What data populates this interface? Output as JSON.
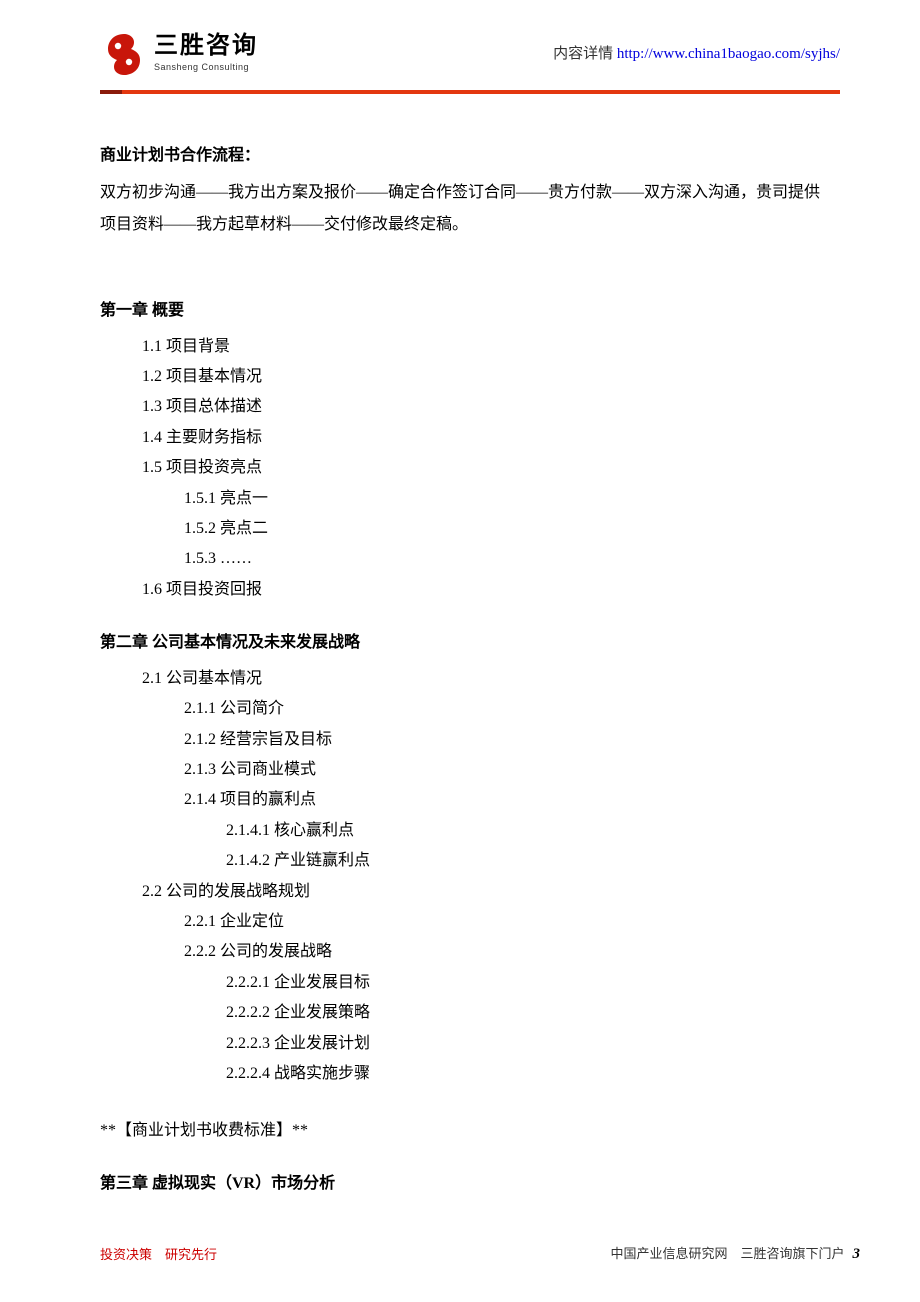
{
  "header": {
    "logo_cn": "三胜咨询",
    "logo_en": "Sansheng Consulting",
    "detail_label": "内容详情",
    "detail_url": "http://www.china1baogao.com/syjhs/"
  },
  "section": {
    "process_title": "商业计划书合作流程：",
    "process_text": "双方初步沟通——我方出方案及报价——确定合作签订合同——贵方付款——双方深入沟通，贵司提供项目资料——我方起草材料——交付修改最终定稿。"
  },
  "chapters": {
    "ch1": {
      "title": "第一章 概要",
      "items_l1": {
        "i0": "1.1 项目背景",
        "i1": "1.2 项目基本情况",
        "i2": "1.3 项目总体描述",
        "i3": "1.4 主要财务指标",
        "i4": "1.5 项目投资亮点",
        "i5": "1.6 项目投资回报"
      },
      "items_l2": {
        "s0": "1.5.1 亮点一",
        "s1": "1.5.2 亮点二",
        "s2": "1.5.3 ……"
      }
    },
    "ch2": {
      "title": "第二章 公司基本情况及未来发展战略",
      "items_l1": {
        "i0": "2.1 公司基本情况",
        "i1": "2.2 公司的发展战略规划"
      },
      "items_l2": {
        "s0": "2.1.1 公司简介",
        "s1": "2.1.2 经营宗旨及目标",
        "s2": "2.1.3 公司商业模式",
        "s3": "2.1.4 项目的赢利点",
        "s4": "2.2.1 企业定位",
        "s5": "2.2.2 公司的发展战略"
      },
      "items_l3": {
        "t0": "2.1.4.1 核心赢利点",
        "t1": "2.1.4.2 产业链赢利点",
        "t2": "2.2.2.1 企业发展目标",
        "t3": "2.2.2.2 企业发展策略",
        "t4": "2.2.2.3 企业发展计划",
        "t5": "2.2.2.4 战略实施步骤"
      }
    },
    "note": "**【商业计划书收费标准】**",
    "ch3": {
      "title": "第三章 虚拟现实（VR）市场分析"
    }
  },
  "footer": {
    "left": "投资决策　研究先行",
    "right": "中国产业信息研究网　三胜咨询旗下门户",
    "page": "3"
  }
}
